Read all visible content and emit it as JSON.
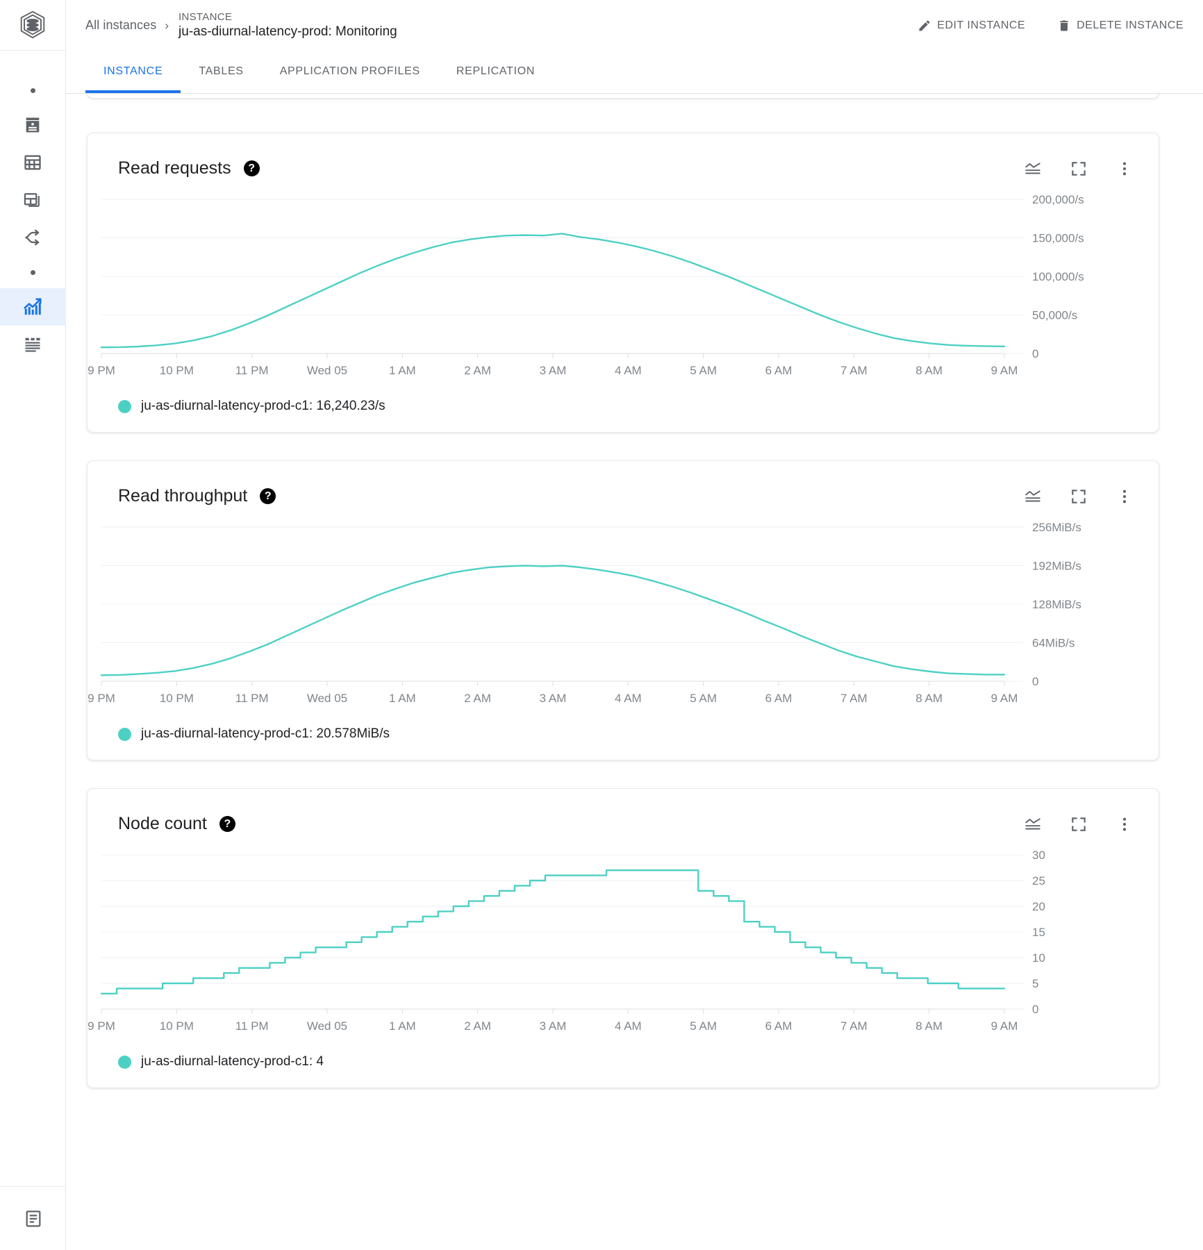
{
  "brand": {
    "accent": "#1a73e8",
    "series_color": "#4dd0c4",
    "logo_name": "bigtable-logo"
  },
  "breadcrumb": {
    "root": "All instances",
    "separator": "›",
    "kind": "INSTANCE",
    "title": "ju-as-diurnal-latency-prod: Monitoring"
  },
  "top_actions": [
    {
      "id": "edit-instance",
      "label": "EDIT INSTANCE",
      "icon": "pencil-icon"
    },
    {
      "id": "delete-instance",
      "label": "DELETE INSTANCE",
      "icon": "trash-icon"
    }
  ],
  "tabs": [
    {
      "id": "instance",
      "label": "INSTANCE",
      "active": true
    },
    {
      "id": "tables",
      "label": "TABLES",
      "active": false
    },
    {
      "id": "application-profiles",
      "label": "APPLICATION PROFILES",
      "active": false
    },
    {
      "id": "replication",
      "label": "REPLICATION",
      "active": false
    }
  ],
  "sidebar": {
    "items": [
      {
        "id": "dot-top",
        "icon": "dot-icon",
        "label": ""
      },
      {
        "id": "instances",
        "icon": "instance-icon",
        "label": ""
      },
      {
        "id": "tables",
        "icon": "table-grid-icon",
        "label": ""
      },
      {
        "id": "app-profiles",
        "icon": "app-profiles-icon",
        "label": ""
      },
      {
        "id": "replication",
        "icon": "replication-branch-icon",
        "label": ""
      },
      {
        "id": "dot-bottom",
        "icon": "dot-icon",
        "label": ""
      },
      {
        "id": "monitoring",
        "icon": "monitoring-chart-icon",
        "label": "",
        "active": true
      },
      {
        "id": "data",
        "icon": "data-rows-icon",
        "label": ""
      }
    ],
    "footer_item": {
      "id": "release-notes",
      "icon": "document-note-icon",
      "label": ""
    }
  },
  "card_tools": [
    {
      "id": "chart-type",
      "icon": "stacked-lines-icon"
    },
    {
      "id": "expand",
      "icon": "fullscreen-icon"
    },
    {
      "id": "more",
      "icon": "more-vert-icon"
    }
  ],
  "help_glyph": "?",
  "chart_data": [
    {
      "id": "read-requests",
      "type": "line",
      "title": "Read requests",
      "xlabel": "",
      "ylabel": "",
      "grid": true,
      "legend_position": "bottom-left",
      "legend": [
        {
          "name": "ju-as-diurnal-latency-prod-c1",
          "value_label": "16,240.23/s",
          "color": "#4dd0c4"
        }
      ],
      "x_ticks": [
        "9 PM",
        "10 PM",
        "11 PM",
        "Wed 05",
        "1 AM",
        "2 AM",
        "3 AM",
        "4 AM",
        "5 AM",
        "6 AM",
        "7 AM",
        "8 AM",
        "9 AM"
      ],
      "y_ticks": [
        "0",
        "50,000/s",
        "100,000/s",
        "150,000/s",
        "200,000/s"
      ],
      "ylim": [
        0,
        200000
      ],
      "series": [
        {
          "name": "ju-as-diurnal-latency-prod-c1",
          "values": [
            8000,
            8200,
            9000,
            10500,
            13000,
            17000,
            22500,
            30000,
            39000,
            49000,
            60000,
            71000,
            82000,
            93000,
            104000,
            114000,
            123000,
            131000,
            138000,
            144000,
            148000,
            151000,
            153000,
            153500,
            153000,
            155500,
            151000,
            148000,
            144000,
            139000,
            133000,
            126000,
            118000,
            109000,
            100000,
            90000,
            80000,
            70000,
            60000,
            50000,
            41000,
            33000,
            26000,
            20000,
            16000,
            13000,
            11000,
            10000,
            9500,
            9200
          ]
        }
      ]
    },
    {
      "id": "read-throughput",
      "type": "line",
      "title": "Read throughput",
      "xlabel": "",
      "ylabel": "",
      "grid": true,
      "legend_position": "bottom-left",
      "legend": [
        {
          "name": "ju-as-diurnal-latency-prod-c1",
          "value_label": "20.578MiB/s",
          "color": "#4dd0c4"
        }
      ],
      "x_ticks": [
        "9 PM",
        "10 PM",
        "11 PM",
        "Wed 05",
        "1 AM",
        "2 AM",
        "3 AM",
        "4 AM",
        "5 AM",
        "6 AM",
        "7 AM",
        "8 AM",
        "9 AM"
      ],
      "y_ticks": [
        "0",
        "64MiB/s",
        "128MiB/s",
        "192MiB/s",
        "256MiB/s"
      ],
      "ylim": [
        0,
        256
      ],
      "series": [
        {
          "name": "ju-as-diurnal-latency-prod-c1",
          "values": [
            10,
            10.5,
            12,
            14,
            17,
            22,
            29,
            38,
            49,
            61,
            75,
            89,
            103,
            117,
            130,
            143,
            154,
            164,
            172,
            180,
            185,
            189,
            191,
            192,
            191,
            192,
            189,
            185,
            180,
            174,
            166,
            157,
            147,
            136,
            125,
            113,
            100,
            88,
            75,
            63,
            51,
            41,
            33,
            25,
            20,
            16,
            13,
            12,
            11,
            11
          ]
        }
      ]
    },
    {
      "id": "node-count",
      "type": "line",
      "title": "Node count",
      "xlabel": "",
      "ylabel": "",
      "grid": true,
      "step": true,
      "legend_position": "bottom-left",
      "legend": [
        {
          "name": "ju-as-diurnal-latency-prod-c1",
          "value_label": "4",
          "color": "#4dd0c4"
        }
      ],
      "x_ticks": [
        "9 PM",
        "10 PM",
        "11 PM",
        "Wed 05",
        "1 AM",
        "2 AM",
        "3 AM",
        "4 AM",
        "5 AM",
        "6 AM",
        "7 AM",
        "8 AM",
        "9 AM"
      ],
      "y_ticks": [
        "0",
        "5",
        "10",
        "15",
        "20",
        "25",
        "30"
      ],
      "ylim": [
        0,
        30
      ],
      "series": [
        {
          "name": "ju-as-diurnal-latency-prod-c1",
          "values": [
            3,
            4,
            4,
            4,
            5,
            5,
            6,
            6,
            7,
            8,
            8,
            9,
            10,
            11,
            12,
            12,
            13,
            14,
            15,
            16,
            17,
            18,
            19,
            20,
            21,
            22,
            23,
            24,
            25,
            26,
            26,
            26,
            26,
            27,
            27,
            27,
            27,
            27,
            27,
            23,
            22,
            21,
            17,
            16,
            15,
            13,
            12,
            11,
            10,
            9,
            8,
            7,
            6,
            6,
            5,
            5,
            4,
            4,
            4,
            4
          ]
        }
      ]
    }
  ]
}
